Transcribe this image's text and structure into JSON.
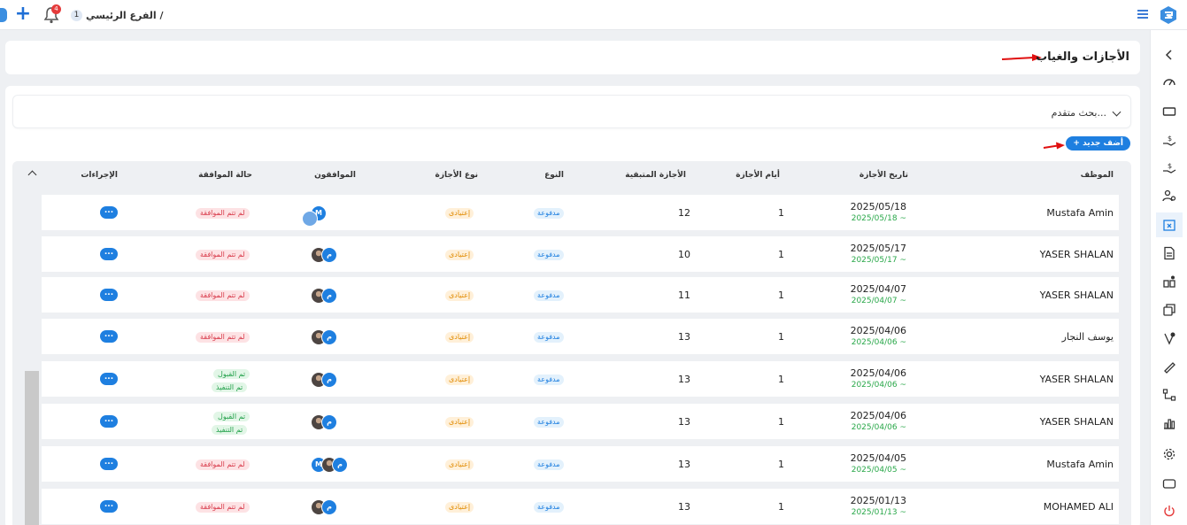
{
  "topbar": {
    "breadcrumb_text": "الفرع الرئيسي /",
    "branch_count": "1",
    "notification_count": "4"
  },
  "page": {
    "title": "الأجازات والغياب"
  },
  "search": {
    "advanced_label": "بحث متقدم..."
  },
  "actions": {
    "add_new_label": "+ أضف جديد"
  },
  "table": {
    "headers": {
      "employee": "الموظف",
      "leave_date": "تاريخ الأجازة",
      "leave_days": "أيام الأجازة",
      "remaining": "الأجازة المتبقية",
      "type": "النوع",
      "leave_type": "نوع الأجازة",
      "approvers": "الموافقون",
      "approval_status": "حالة الموافقة",
      "procedures": "الإجراءات"
    },
    "rows": [
      {
        "employee": "Mustafa Amin",
        "date_from": "2025/05/18",
        "date_to": "2025/05/18 ~",
        "days": "1",
        "remaining": "12",
        "type": "مدفوعة",
        "leave_type": "إعتيادى",
        "approvers": [
          {
            "kind": "logo",
            "letter": ""
          },
          {
            "kind": "blue",
            "letter": "M"
          }
        ],
        "status": [
          "لم تتم الموافقة"
        ],
        "action": "..."
      },
      {
        "employee": "YASER SHALAN",
        "date_from": "2025/05/17",
        "date_to": "2025/05/17 ~",
        "days": "1",
        "remaining": "10",
        "type": "مدفوعة",
        "leave_type": "إعتيادى",
        "approvers": [
          {
            "kind": "blue",
            "letter": "م"
          },
          {
            "kind": "photo",
            "letter": ""
          }
        ],
        "status": [
          "لم تتم الموافقة"
        ],
        "action": "..."
      },
      {
        "employee": "YASER SHALAN",
        "date_from": "2025/04/07",
        "date_to": "2025/04/07 ~",
        "days": "1",
        "remaining": "11",
        "type": "مدفوعة",
        "leave_type": "إعتيادى",
        "approvers": [
          {
            "kind": "blue",
            "letter": "م"
          },
          {
            "kind": "photo",
            "letter": ""
          }
        ],
        "status": [
          "لم تتم الموافقة"
        ],
        "action": "..."
      },
      {
        "employee": "يوسف النجار",
        "date_from": "2025/04/06",
        "date_to": "2025/04/06 ~",
        "days": "1",
        "remaining": "13",
        "type": "مدفوعة",
        "leave_type": "إعتيادى",
        "approvers": [
          {
            "kind": "blue",
            "letter": "م"
          },
          {
            "kind": "photo",
            "letter": ""
          }
        ],
        "status": [
          "لم تتم الموافقة"
        ],
        "action": "..."
      },
      {
        "employee": "YASER SHALAN",
        "date_from": "2025/04/06",
        "date_to": "2025/04/06 ~",
        "days": "1",
        "remaining": "13",
        "type": "مدفوعة",
        "leave_type": "إعتيادى",
        "approvers": [
          {
            "kind": "blue",
            "letter": "م"
          },
          {
            "kind": "photo",
            "letter": ""
          }
        ],
        "status": [
          "تم القبول",
          "تم التنفيذ"
        ],
        "action": "..."
      },
      {
        "employee": "YASER SHALAN",
        "date_from": "2025/04/06",
        "date_to": "2025/04/06 ~",
        "days": "1",
        "remaining": "13",
        "type": "مدفوعة",
        "leave_type": "إعتيادى",
        "approvers": [
          {
            "kind": "blue",
            "letter": "م"
          },
          {
            "kind": "photo",
            "letter": ""
          }
        ],
        "status": [
          "تم القبول",
          "تم التنفيذ"
        ],
        "action": "..."
      },
      {
        "employee": "Mustafa Amin",
        "date_from": "2025/04/05",
        "date_to": "2025/04/05 ~",
        "days": "1",
        "remaining": "13",
        "type": "مدفوعة",
        "leave_type": "إعتيادى",
        "approvers": [
          {
            "kind": "blue",
            "letter": "م"
          },
          {
            "kind": "photo",
            "letter": ""
          },
          {
            "kind": "blue",
            "letter": "M"
          }
        ],
        "status": [
          "لم تتم الموافقة"
        ],
        "action": "..."
      },
      {
        "employee": "MOHAMED ALI",
        "date_from": "2025/01/13",
        "date_to": "2025/01/13 ~",
        "days": "1",
        "remaining": "13",
        "type": "مدفوعة",
        "leave_type": "إعتيادى",
        "approvers": [
          {
            "kind": "blue",
            "letter": "م"
          },
          {
            "kind": "photo",
            "letter": ""
          }
        ],
        "status": [
          "لم تتم الموافقة"
        ],
        "action": "..."
      }
    ]
  },
  "sidebar": {
    "items": [
      {
        "icon": "chevron-left-icon"
      },
      {
        "icon": "dashboard-gauge-icon"
      },
      {
        "icon": "ticket-icon"
      },
      {
        "icon": "hand-money-icon"
      },
      {
        "icon": "hand-coins-icon"
      },
      {
        "icon": "users-settings-icon"
      },
      {
        "icon": "calendar-x-icon"
      },
      {
        "icon": "document-icon"
      },
      {
        "icon": "apps-icon"
      },
      {
        "icon": "cards-icon"
      },
      {
        "icon": "certificate-icon"
      },
      {
        "icon": "signature-pen-icon"
      },
      {
        "icon": "hierarchy-icon"
      },
      {
        "icon": "bar-chart-icon"
      },
      {
        "icon": "gear-icon"
      },
      {
        "icon": "monitor-icon"
      },
      {
        "icon": "power-icon"
      }
    ]
  },
  "colors": {
    "accent": "#1e7fe0",
    "success": "#22a04a",
    "danger": "#d83a4a",
    "warning": "#e08a00",
    "annotation_arrow": "#e01010"
  }
}
